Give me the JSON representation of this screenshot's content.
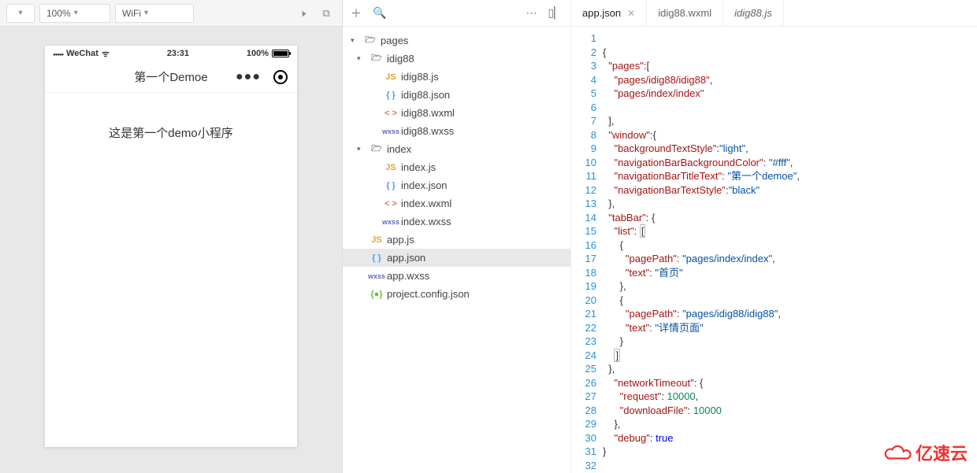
{
  "toolbar": {
    "zoom": "100%",
    "network": "WiFi"
  },
  "simulator": {
    "status": {
      "carrier": "WeChat",
      "time": "23:31",
      "battery": "100%"
    },
    "title": "第一个Demoe",
    "body_text": "这是第一个demo小程序"
  },
  "tree": {
    "root": "pages",
    "folders": [
      {
        "name": "idig88",
        "files": [
          "idig88.js",
          "idig88.json",
          "idig88.wxml",
          "idig88.wxss"
        ]
      },
      {
        "name": "index",
        "files": [
          "index.js",
          "index.json",
          "index.wxml",
          "index.wxss"
        ]
      }
    ],
    "rootfiles": [
      "app.js",
      "app.json",
      "app.wxss",
      "project.config.json"
    ],
    "selected": "app.json"
  },
  "tabs": [
    {
      "label": "app.json",
      "active": true
    },
    {
      "label": "idig88.wxml",
      "active": false
    },
    {
      "label": "idig88.js",
      "active": false,
      "italic": true
    }
  ],
  "code_lines": [
    "",
    "{",
    "  §pages§:[",
    "    §pages/idig88/idig88§,",
    "    §pages/index/index§",
    "",
    "  ],",
    "  §window§:{",
    "    §backgroundTextStyle§:§light§,",
    "    §navigationBarBackgroundColor§: §#fff§,",
    "    §navigationBarTitleText§: §第一个demoe§,",
    "    §navigationBarTextStyle§:§black§",
    "  },",
    "  §tabBar§: {",
    "    §list§: ¶[¶",
    "      {",
    "        §pagePath§: §pages/index/index§,",
    "        §text§: §首页§",
    "      },",
    "      {",
    "        §pagePath§: §pages/idig88/idig88§,",
    "        §text§: §详情页面§",
    "      }",
    "    ¶]¶",
    "  },",
    "    §networkTimeout§: {",
    "      §request§: #10000#,",
    "      §downloadFile§: #10000#",
    "    },",
    "    §debug§: ~true~",
    "}",
    ""
  ],
  "watermark": "亿速云"
}
